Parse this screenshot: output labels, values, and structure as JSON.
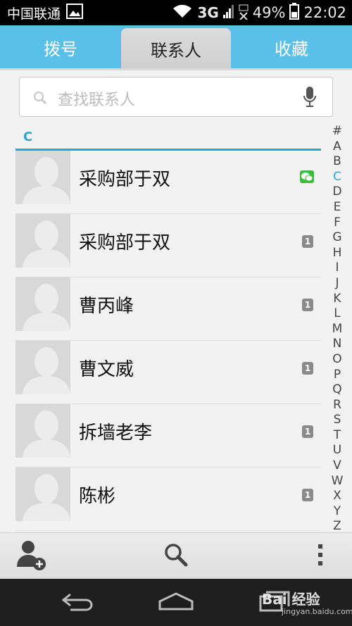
{
  "status_bar": {
    "carrier": "中国联通",
    "network": "3G",
    "battery": "49%",
    "time": "22:02"
  },
  "tabs": [
    {
      "label": "拨号"
    },
    {
      "label": "联系人"
    },
    {
      "label": "收藏"
    }
  ],
  "search": {
    "placeholder": "查找联系人"
  },
  "section": {
    "letter": "C"
  },
  "contacts": [
    {
      "name": "采购部于双",
      "badge": "wechat"
    },
    {
      "name": "采购部于双",
      "badge": "1"
    },
    {
      "name": "曹丙峰",
      "badge": "1"
    },
    {
      "name": "曹文威",
      "badge": "1"
    },
    {
      "name": "拆墙老李",
      "badge": "1"
    },
    {
      "name": "陈彬",
      "badge": "1"
    }
  ],
  "alphabet": [
    "#",
    "A",
    "B",
    "C",
    "D",
    "E",
    "F",
    "G",
    "H",
    "I",
    "J",
    "K",
    "L",
    "M",
    "N",
    "O",
    "P",
    "Q",
    "R",
    "S",
    "T",
    "U",
    "V",
    "W",
    "X",
    "Y",
    "Z"
  ],
  "alphabet_active": "C",
  "watermark": {
    "brand": "Bai 经验",
    "url": "jingyan.baidu.com"
  },
  "colors": {
    "tab_bar": "#5bc0e8",
    "accent": "#2aa5d8",
    "wechat": "#3dbb3d"
  }
}
